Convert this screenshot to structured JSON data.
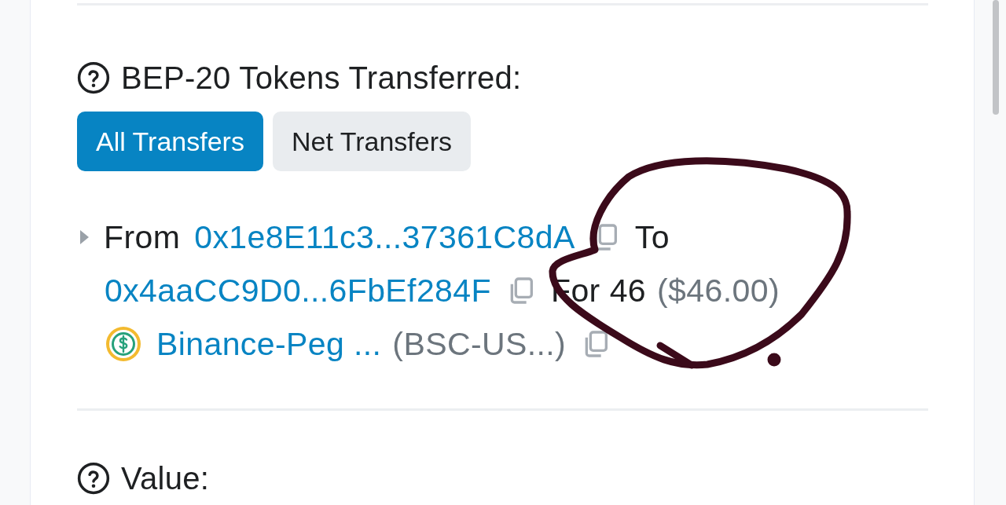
{
  "section": {
    "heading": "BEP-20 Tokens Transferred:"
  },
  "tabs": [
    {
      "label": "All Transfers",
      "selected": true
    },
    {
      "label": "Net Transfers",
      "selected": false
    }
  ],
  "transfers": [
    {
      "expanded": false,
      "from_label": "From",
      "from_address": "0x1e8E11c3...37361C8dA",
      "to_label": "To",
      "to_address": "0x4aaCC9D0...6FbEf284F",
      "for_label": "For",
      "amount": "46",
      "usd_value": "($46.00)",
      "token_name": "Binance-Peg ...",
      "token_symbol": "(BSC-US...)"
    }
  ],
  "next_section": {
    "heading": "Value:"
  }
}
